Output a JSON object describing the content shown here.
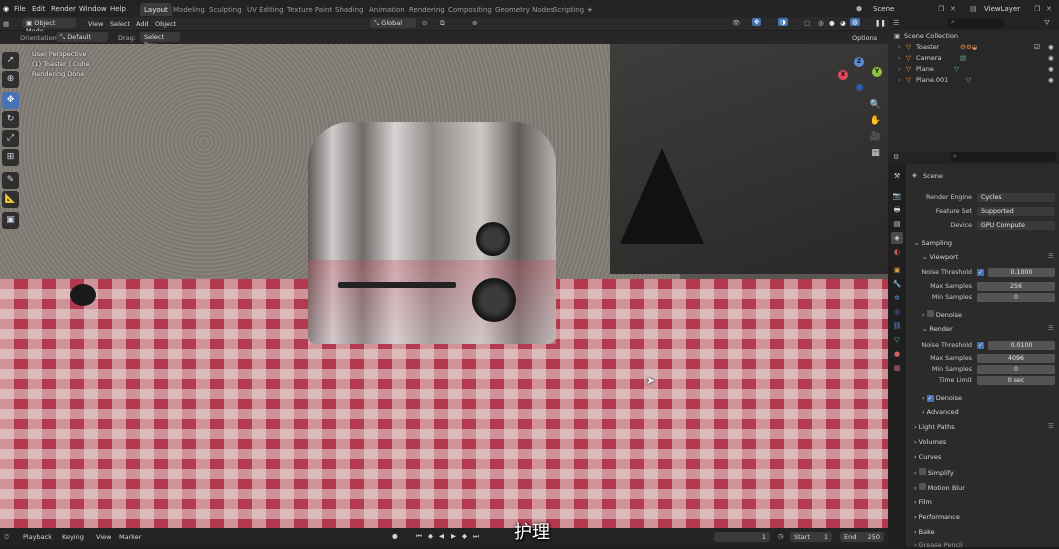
{
  "topbar": {
    "menus": [
      "File",
      "Edit",
      "Render",
      "Window",
      "Help"
    ],
    "workspaces": [
      "Layout",
      "Modeling",
      "Sculpting",
      "UV Editing",
      "Texture Paint",
      "Shading",
      "Animation",
      "Rendering",
      "Compositing",
      "Geometry Nodes",
      "Scripting"
    ],
    "active_workspace": "Layout",
    "add_tab": "+",
    "scene": "Scene",
    "view_layer": "ViewLayer"
  },
  "vp_header": {
    "mode": "Object Mode",
    "menus": [
      "View",
      "Select",
      "Add",
      "Object"
    ],
    "transform": "Global"
  },
  "vp_tool": {
    "orientation_label": "Orientation:",
    "orientation_value": "Default",
    "drag_label": "Drag:",
    "drag_value": "Select Box",
    "options": "Options"
  },
  "viewport": {
    "perspective": "User Perspective",
    "object": "(1) Toaster | Cube",
    "status": "Rendering Done"
  },
  "gizmo": {
    "x": "X",
    "y": "Y",
    "z": "Z"
  },
  "timeline": {
    "menus": [
      "Playback",
      "Keying",
      "View",
      "Marker"
    ],
    "current_frame": "1",
    "start_label": "Start",
    "start": "1",
    "end_label": "End",
    "end": "250"
  },
  "outliner": {
    "root": "Scene Collection",
    "items": [
      "Toaster",
      "Camera",
      "Plane",
      "Plane.001"
    ]
  },
  "properties": {
    "scene": "Scene",
    "render_engine_label": "Render Engine",
    "render_engine": "Cycles",
    "feature_set_label": "Feature Set",
    "feature_set": "Supported",
    "device_label": "Device",
    "device": "GPU Compute",
    "sampling": "Sampling",
    "viewport": "Viewport",
    "vp_noise_label": "Noise Threshold",
    "vp_noise": "0.1000",
    "vp_max_label": "Max Samples",
    "vp_max": "256",
    "vp_min_label": "Min Samples",
    "vp_min": "0",
    "vp_denoise": "Denoise",
    "render": "Render",
    "r_noise_label": "Noise Threshold",
    "r_noise": "0.0100",
    "r_max_label": "Max Samples",
    "r_max": "4096",
    "r_min_label": "Min Samples",
    "r_min": "0",
    "r_time_label": "Time Limit",
    "r_time": "0 sec",
    "r_denoise": "Denoise",
    "advanced": "Advanced",
    "sections": [
      "Light Paths",
      "Volumes",
      "Curves",
      "Simplify",
      "Motion Blur",
      "Film",
      "Performance",
      "Bake",
      "Grease Pencil"
    ]
  },
  "subtitle": "护理",
  "colors": {
    "accent": "#4772b3",
    "header": "#232323",
    "panel": "#2b2b2b"
  }
}
